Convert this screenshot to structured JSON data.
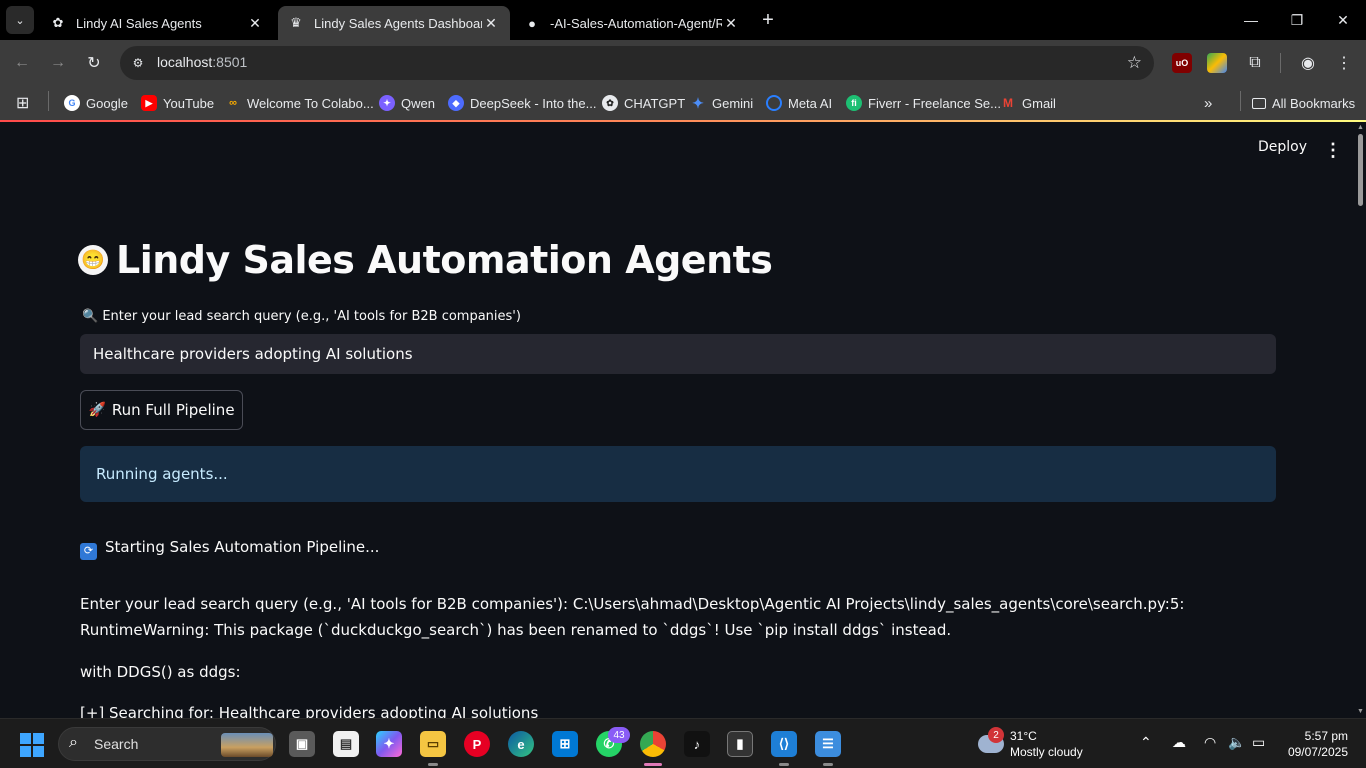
{
  "browser": {
    "tabs": [
      {
        "title": "Lindy AI Sales Agents",
        "favicon": "openai-icon",
        "active": false
      },
      {
        "title": "Lindy Sales Agents Dashboard",
        "favicon": "crown-icon",
        "active": true
      },
      {
        "title": "-AI-Sales-Automation-Agent/RE",
        "favicon": "github-icon",
        "active": false
      }
    ],
    "url": {
      "host": "localhost",
      "port": ":8501"
    },
    "bookmarks": [
      {
        "label": "Google",
        "color": "#ffffff"
      },
      {
        "label": "YouTube",
        "color": "#ff0000"
      },
      {
        "label": "Welcome To Colabo...",
        "color": "#f9ab00"
      },
      {
        "label": "Qwen",
        "color": "#7b61ff"
      },
      {
        "label": "DeepSeek - Into the...",
        "color": "#4d6bfe"
      },
      {
        "label": "CHATGPT",
        "color": "#e8eaed"
      },
      {
        "label": "Gemini",
        "color": "#4c8df6"
      },
      {
        "label": "Meta AI",
        "color": "#2a7fff"
      },
      {
        "label": "Fiverr - Freelance Se...",
        "color": "#1dbf73"
      },
      {
        "label": "Gmail",
        "color": "#ea4335"
      }
    ],
    "all_bookmarks": "All Bookmarks"
  },
  "app": {
    "deploy_label": "Deploy",
    "title_emoji": "😁",
    "title": "Lindy Sales Automation Agents",
    "input_label": "🔍 Enter your lead search query (e.g., 'AI tools for B2B companies')",
    "input_value": "Healthcare providers adopting AI solutions",
    "run_button": "Run Full Pipeline",
    "run_button_icon": "🚀",
    "status": "Running agents...",
    "log": [
      "Starting Sales Automation Pipeline...",
      "Enter your lead search query (e.g., 'AI tools for B2B companies'): C:\\Users\\ahmad\\Desktop\\Agentic AI Projects\\lindy_sales_agents\\core\\search.py:5: RuntimeWarning: This package (`duckduckgo_search`) has been renamed to `ddgs`! Use `pip install ddgs` instead.",
      "with DDGS() as ddgs:",
      "[+] Searching for: Healthcare providers adopting AI solutions"
    ]
  },
  "taskbar": {
    "search_label": "Search",
    "whatsapp_badge": "43",
    "weather_badge": "2",
    "temperature": "31°C",
    "weather_desc": "Mostly cloudy",
    "time": "5:57 pm",
    "date": "09/07/2025"
  }
}
